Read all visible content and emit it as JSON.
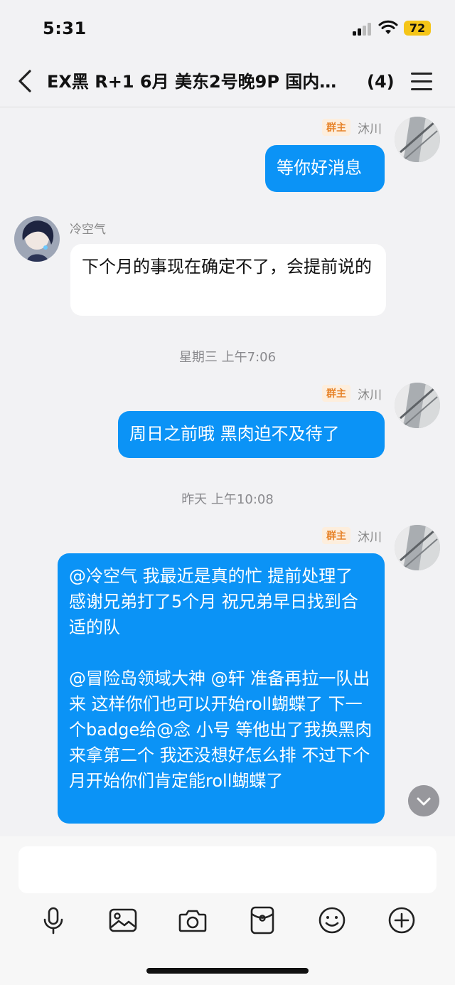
{
  "status_bar": {
    "time": "5:31",
    "battery": "72"
  },
  "nav": {
    "title": "EX黑 R+1 6月 美东2号晚9P 国内…",
    "member_count": "(4)"
  },
  "messages": [
    {
      "sender": "沐川",
      "badge": "群主",
      "text": "等你好消息"
    },
    {
      "sender": "冷空气",
      "text": "下个月的事现在确定不了，会提前说的"
    },
    {
      "sender": "沐川",
      "badge": "群主",
      "text": "周日之前哦 黑肉迫不及待了"
    },
    {
      "sender": "沐川",
      "badge": "群主",
      "text": "@冷空气 我最近是真的忙 提前处理了 感谢兄弟打了5个月 祝兄弟早日找到合适的队\n\n@冒险岛领域大神 @轩 准备再拉一队出来 这样你们也可以开始roll蝴蝶了 下一个badge给@念 小号 等他出了我换黑肉来拿第二个 我还没想好怎么排 不过下个月开始你们肯定能roll蝴蝶了"
    }
  ],
  "timestamps": [
    "星期三 上午7:06",
    "昨天 上午10:08"
  ],
  "input": {
    "value": "",
    "placeholder": ""
  },
  "toolbar_icons": [
    "microphone-icon",
    "image-icon",
    "camera-icon",
    "red-packet-icon",
    "emoji-icon",
    "plus-icon"
  ]
}
